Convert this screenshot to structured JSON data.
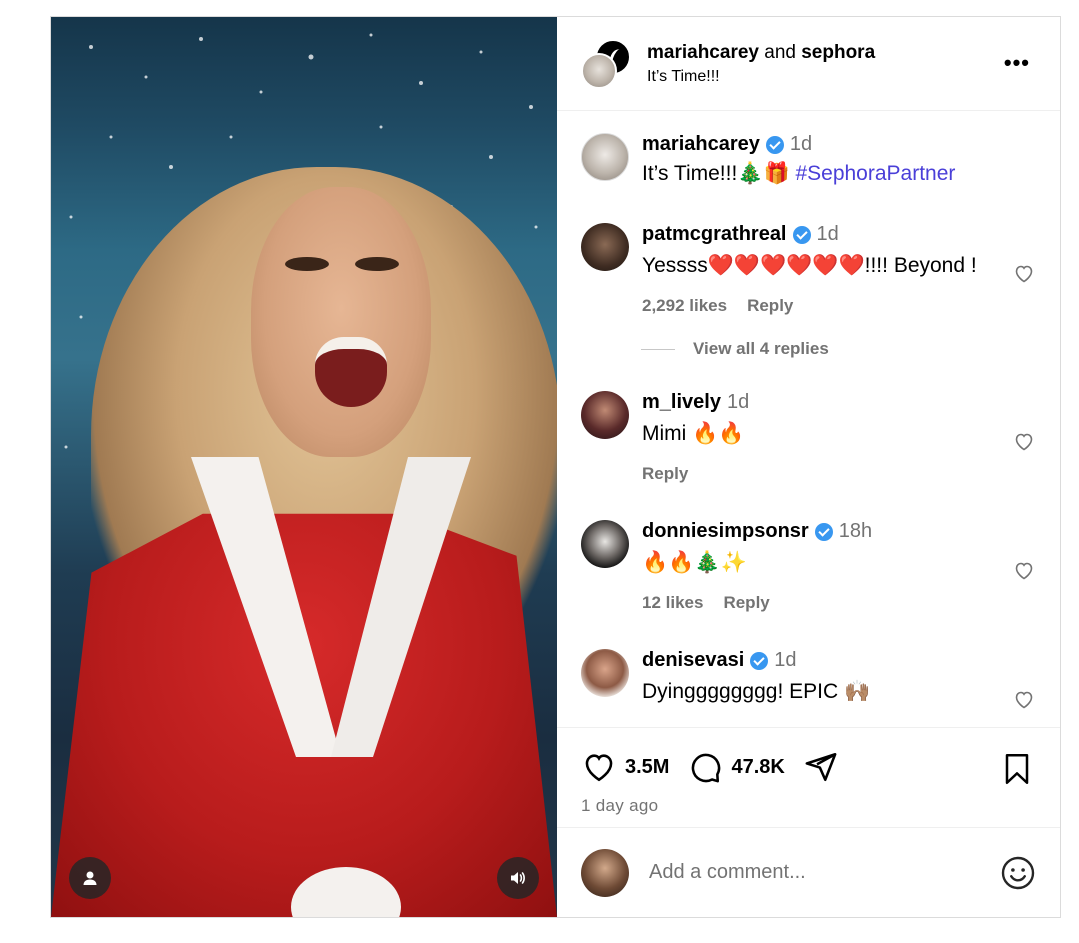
{
  "header": {
    "user1": "mariahcarey",
    "joiner": "and",
    "user2": "sephora",
    "caption": "It’s Time!!!",
    "more_label": "•••"
  },
  "caption_comment": {
    "username": "mariahcarey",
    "verified": true,
    "time": "1d",
    "text": "It’s Time!!!🎄🎁",
    "hashtag": "#SephoraPartner"
  },
  "comments": [
    {
      "username": "patmcgrathreal",
      "verified": true,
      "time": "1d",
      "text": "Yessss❤️❤️❤️❤️❤️❤️!!!! Beyond !",
      "likes": "2,292 likes",
      "reply_label": "Reply",
      "view_replies": "View all 4 replies"
    },
    {
      "username": "m_lively",
      "verified": false,
      "time": "1d",
      "text": "Mimi 🔥🔥",
      "reply_label": "Reply"
    },
    {
      "username": "donniesimpsonsr",
      "verified": true,
      "time": "18h",
      "text": "🔥🔥🎄✨",
      "likes": "12 likes",
      "reply_label": "Reply"
    },
    {
      "username": "denisevasi",
      "verified": true,
      "time": "1d",
      "text": "Dyingggggggg! EPIC 🙌🏽"
    }
  ],
  "actions": {
    "like_count": "3.5M",
    "comment_count": "47.8K",
    "time_ago": "1 day ago"
  },
  "add_comment": {
    "placeholder": "Add a comment..."
  },
  "icons": {
    "user_tag": "user-icon",
    "sound": "volume-icon",
    "like": "heart-icon",
    "comment": "comment-icon",
    "share": "send-icon",
    "save": "bookmark-icon",
    "emoji": "emoji-icon"
  }
}
